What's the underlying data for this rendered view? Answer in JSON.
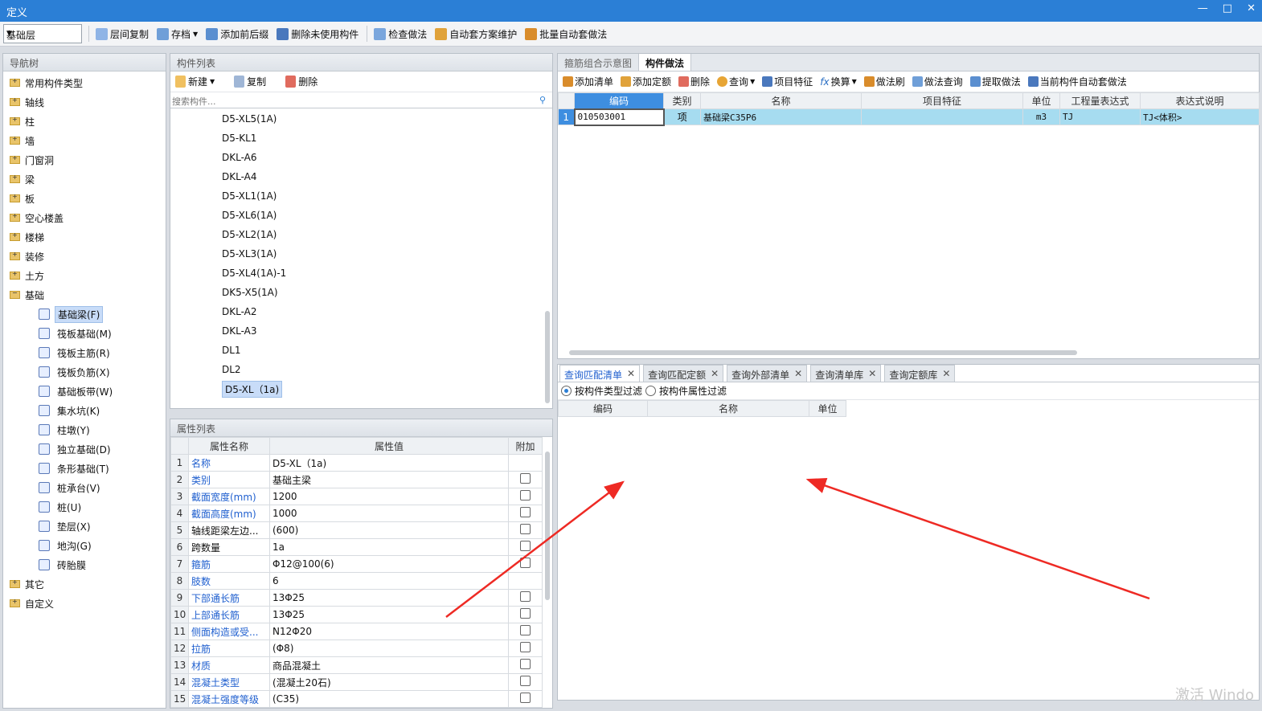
{
  "window": {
    "title": "定义",
    "minimize": "—",
    "maximize": "□",
    "close": "✕"
  },
  "toolbar": {
    "floor_select": "基础层",
    "items": [
      {
        "label": "层间复制",
        "icon": "copy-icon"
      },
      {
        "label": "存档",
        "icon": "archive-icon"
      },
      {
        "label": "添加前后缀",
        "icon": "prefix-icon"
      },
      {
        "label": "删除未使用构件",
        "icon": "delete-unused-icon"
      },
      {
        "label": "检查做法",
        "icon": "check-icon"
      },
      {
        "label": "自动套方案维护",
        "icon": "auto-plan-icon"
      },
      {
        "label": "批量自动套做法",
        "icon": "batch-icon"
      }
    ]
  },
  "nav": {
    "header": "导航树",
    "folders": [
      "常用构件类型",
      "轴线",
      "柱",
      "墙",
      "门窗洞",
      "梁",
      "板",
      "空心楼盖",
      "楼梯",
      "装修",
      "土方",
      "基础"
    ],
    "foundation_children": [
      "基础梁(F)",
      "筏板基础(M)",
      "筏板主筋(R)",
      "筏板负筋(X)",
      "基础板带(W)",
      "集水坑(K)",
      "柱墩(Y)",
      "独立基础(D)",
      "条形基础(T)",
      "桩承台(V)",
      "桩(U)",
      "垫层(X)",
      "地沟(G)",
      "砖胎膜"
    ],
    "tail_folders": [
      "其它",
      "自定义"
    ]
  },
  "components": {
    "header": "构件列表",
    "new_label": "新建",
    "copy_label": "复制",
    "delete_label": "删除",
    "search_placeholder": "搜索构件...",
    "items": [
      "D5-XL5(1A)",
      "D5-KL1",
      "DKL-A6",
      "DKL-A4",
      "D5-XL1(1A)",
      "D5-XL6(1A)",
      "D5-XL2(1A)",
      "D5-XL3(1A)",
      "D5-XL4(1A)-1",
      "DK5-X5(1A)",
      "DKL-A2",
      "DKL-A3",
      "DL1",
      "DL2",
      "D5-XL（1a)"
    ]
  },
  "properties": {
    "header": "属性列表",
    "columns": [
      "属性名称",
      "属性值",
      "附加"
    ],
    "rows": [
      {
        "n": "1",
        "name": "名称",
        "value": "D5-XL（1a)",
        "blue": true,
        "check": false
      },
      {
        "n": "2",
        "name": "类别",
        "value": "基础主梁",
        "blue": true,
        "check": true
      },
      {
        "n": "3",
        "name": "截面宽度(mm)",
        "value": "1200",
        "blue": true,
        "check": true
      },
      {
        "n": "4",
        "name": "截面高度(mm)",
        "value": "1000",
        "blue": true,
        "check": true
      },
      {
        "n": "5",
        "name": "轴线距梁左边...",
        "value": "(600)",
        "blue": false,
        "check": true
      },
      {
        "n": "6",
        "name": "跨数量",
        "value": "1a",
        "blue": false,
        "check": true
      },
      {
        "n": "7",
        "name": "箍筋",
        "value": "Φ12@100(6)",
        "blue": true,
        "check": true
      },
      {
        "n": "8",
        "name": "肢数",
        "value": "6",
        "blue": true,
        "check": false
      },
      {
        "n": "9",
        "name": "下部通长筋",
        "value": "13Φ25",
        "blue": true,
        "check": true
      },
      {
        "n": "10",
        "name": "上部通长筋",
        "value": "13Φ25",
        "blue": true,
        "check": true
      },
      {
        "n": "11",
        "name": "侧面构造或受...",
        "value": "N12Φ20",
        "blue": true,
        "check": true
      },
      {
        "n": "12",
        "name": "拉筋",
        "value": "(Φ8)",
        "blue": true,
        "check": true
      },
      {
        "n": "13",
        "name": "材质",
        "value": "商品混凝土",
        "blue": true,
        "check": true
      },
      {
        "n": "14",
        "name": "混凝土类型",
        "value": "(混凝土20石)",
        "blue": true,
        "check": true
      },
      {
        "n": "15",
        "name": "混凝土强度等级",
        "value": "(C35)",
        "blue": true,
        "check": true
      }
    ]
  },
  "method": {
    "tabs": [
      "箍筋组合示意图",
      "构件做法"
    ],
    "tools": [
      {
        "label": "添加清单",
        "icon": "add-list-icon"
      },
      {
        "label": "添加定额",
        "icon": "add-quota-icon"
      },
      {
        "label": "删除",
        "icon": "delete-icon"
      },
      {
        "label": "查询",
        "icon": "query-icon"
      },
      {
        "label": "项目特征",
        "icon": "feature-icon"
      },
      {
        "label": "换算",
        "icon": "fx-icon"
      },
      {
        "label": "做法刷",
        "icon": "brush-icon"
      },
      {
        "label": "做法查询",
        "icon": "method-query-icon"
      },
      {
        "label": "提取做法",
        "icon": "extract-icon"
      },
      {
        "label": "当前构件自动套做法",
        "icon": "auto-apply-icon"
      }
    ],
    "columns": [
      "编码",
      "类别",
      "名称",
      "项目特征",
      "单位",
      "工程量表达式",
      "表达式说明"
    ],
    "rows": [
      {
        "n": "1",
        "code": "010503001",
        "type": "项",
        "name": "基础梁C35P6",
        "feature": "",
        "unit": "m3",
        "expr": "TJ",
        "desc": "TJ<体积>"
      }
    ]
  },
  "query": {
    "tabs": [
      "查询匹配清单",
      "查询匹配定额",
      "查询外部清单",
      "查询清单库",
      "查询定额库"
    ],
    "filter_type": "按构件类型过滤",
    "filter_attr": "按构件属性过滤",
    "columns": [
      "编码",
      "名称",
      "单位"
    ]
  },
  "watermark": "激活 Windo",
  "colors": {
    "titlebar": "#2b7fd6",
    "selection": "#c8dcf8",
    "row_highlight": "#a6dcf0",
    "arrow": "#ee2a24"
  }
}
